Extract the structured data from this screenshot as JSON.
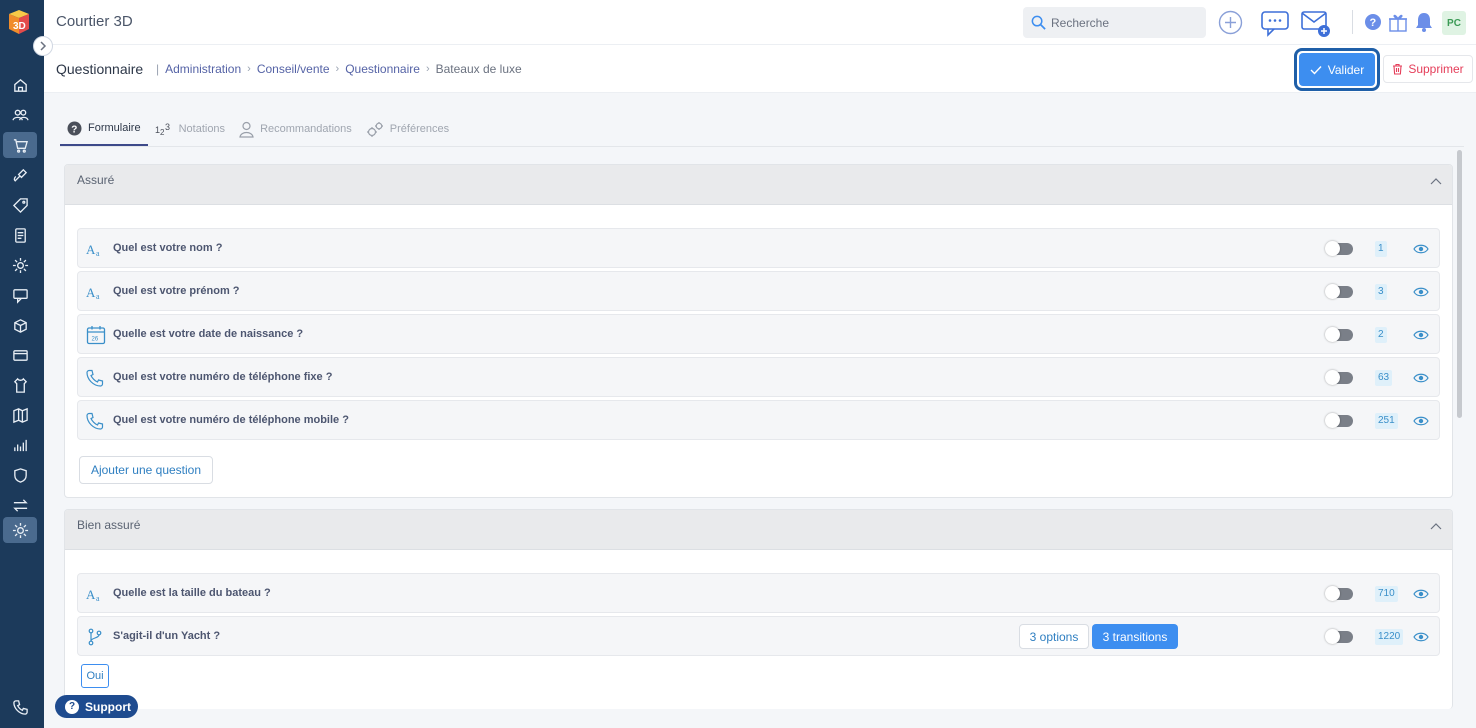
{
  "app": {
    "title": "Courtier 3D"
  },
  "search": {
    "placeholder": "Recherche"
  },
  "user": {
    "initials": "PC"
  },
  "page": {
    "title": "Questionnaire",
    "breadcrumb": [
      "Administration",
      "Conseil/vente",
      "Questionnaire",
      "Bateaux de luxe"
    ]
  },
  "actions": {
    "validate": "Valider",
    "delete": "Supprimer"
  },
  "tabs": [
    {
      "label": "Formulaire",
      "active": true
    },
    {
      "label": "Notations",
      "active": false
    },
    {
      "label": "Recommandations",
      "active": false
    },
    {
      "label": "Préférences",
      "active": false
    }
  ],
  "sections": [
    {
      "title": "Assuré",
      "questions": [
        {
          "icon": "text-icon",
          "label": "Quel est votre nom ?",
          "badge": "1"
        },
        {
          "icon": "calendar-icon-alt",
          "label": "Quel est votre prénom ?",
          "badge": "3"
        },
        {
          "icon": "calendar-icon",
          "label": "Quelle est votre date de naissance ?",
          "badge": "2"
        },
        {
          "icon": "phone-icon",
          "label": "Quel est votre numéro de téléphone fixe ?",
          "badge": "63"
        },
        {
          "icon": "phone-icon",
          "label": "Quel est votre numéro de téléphone mobile ?",
          "badge": "251"
        }
      ],
      "add_label": "Ajouter une question"
    },
    {
      "title": "Bien assuré",
      "questions": [
        {
          "icon": "text-icon",
          "label": "Quelle est la taille du bateau ?",
          "badge": "710"
        },
        {
          "icon": "branch-icon",
          "label": "S'agit-il d'un Yacht ?",
          "badge": "1220",
          "options": "3 options",
          "transitions": "3 transitions"
        }
      ],
      "answer": "Oui"
    }
  ],
  "calendar_day": "26",
  "support": {
    "label": "Support"
  },
  "colors": {
    "sidebar": "#1c3a5b",
    "primary": "#3d8ef0",
    "danger": "#e53e5a",
    "accent": "#3a8fc9"
  }
}
